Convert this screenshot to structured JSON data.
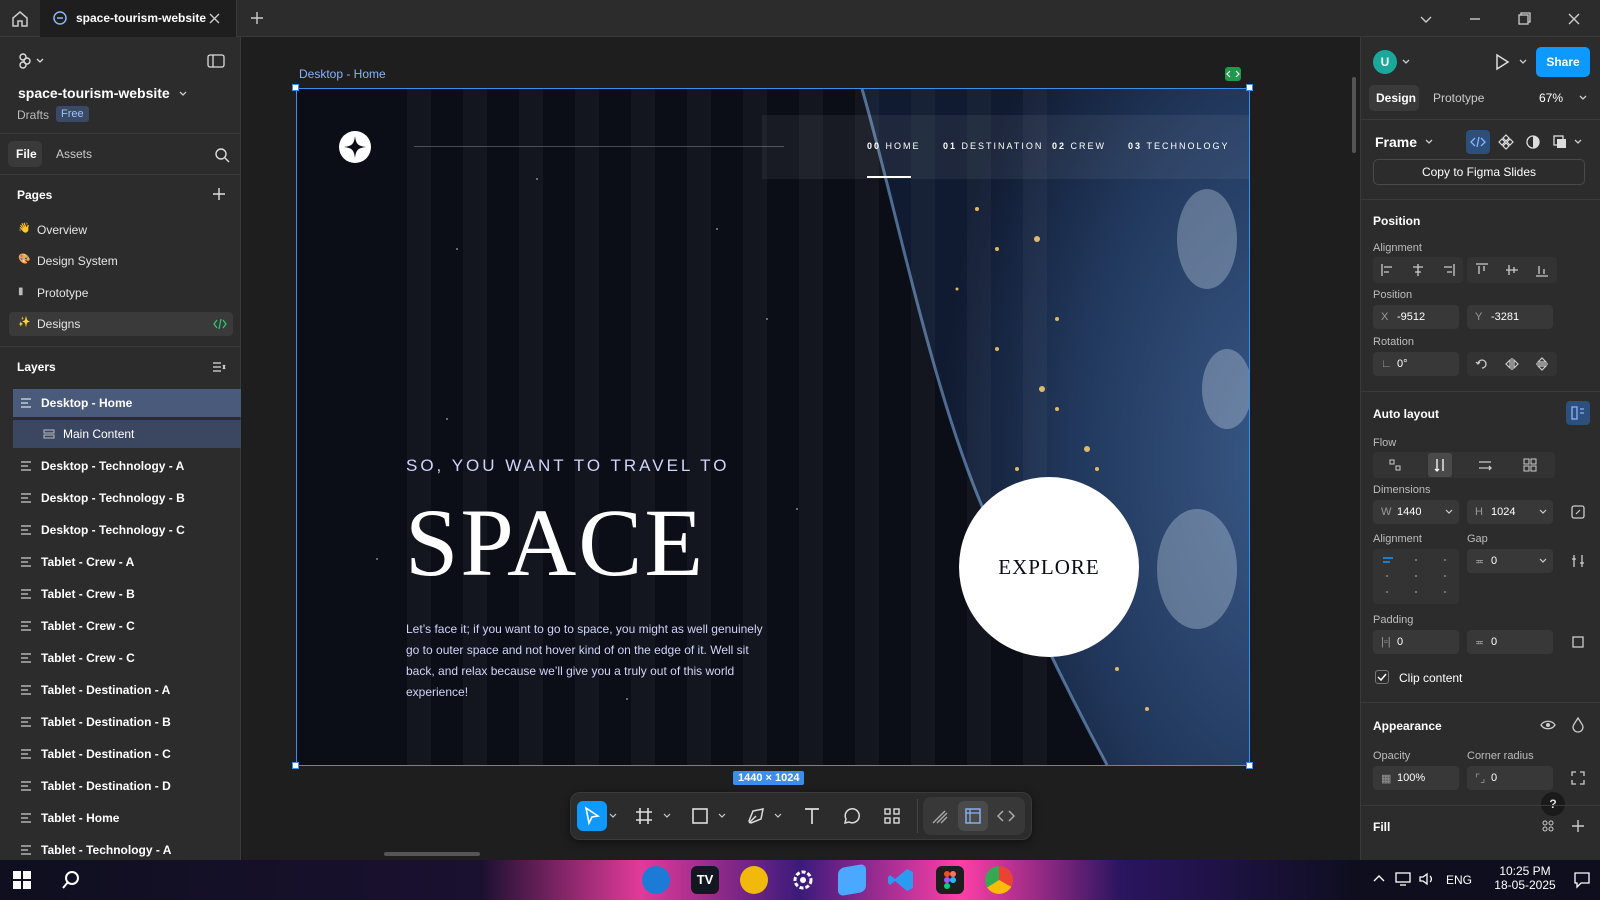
{
  "titlebar": {
    "tab_title": "space-tourism-website"
  },
  "left_panel": {
    "file_name": "space-tourism-website",
    "drafts": "Drafts",
    "plan_badge": "Free",
    "tabs": {
      "file": "File",
      "assets": "Assets"
    },
    "pages_heading": "Pages",
    "pages": [
      {
        "label": "Overview",
        "emoji": "👋"
      },
      {
        "label": "Design System",
        "emoji": "🎨"
      },
      {
        "label": "Prototype",
        "emoji": "▮"
      },
      {
        "label": "Designs",
        "emoji": "✨"
      }
    ],
    "layers_heading": "Layers",
    "layers": [
      "Desktop - Home",
      "Main Content",
      "Desktop - Technology - A",
      "Desktop - Technology - B",
      "Desktop - Technology - C",
      "Tablet - Crew - A",
      "Tablet - Crew - B",
      "Tablet - Crew - C",
      "Tablet - Crew - C",
      "Tablet - Destination - A",
      "Tablet - Destination - B",
      "Tablet - Destination - C",
      "Tablet - Destination - D",
      "Tablet - Home",
      "Tablet - Technology - A"
    ]
  },
  "canvas": {
    "frame_label": "Desktop - Home",
    "size_badge": "1440 × 1024",
    "site": {
      "nav": [
        {
          "num": "00",
          "label": "HOME"
        },
        {
          "num": "01",
          "label": "DESTINATION"
        },
        {
          "num": "02",
          "label": "CREW"
        },
        {
          "num": "03",
          "label": "TECHNOLOGY"
        }
      ],
      "subtitle": "SO, YOU WANT TO TRAVEL TO",
      "headline": "SPACE",
      "body": "Let’s face it; if you want to go to space, you might as well genuinely go to outer space and not hover kind of on the edge of it. Well sit back, and relax because we’ll give you a truly out of this world experience!",
      "cta": "EXPLORE"
    }
  },
  "right_panel": {
    "tabs": {
      "design": "Design",
      "prototype": "Prototype"
    },
    "zoom": "67%",
    "avatar": "U",
    "share": "Share",
    "frame_label": "Frame",
    "copy_button": "Copy to Figma Slides",
    "position_heading": "Position",
    "alignment_label": "Alignment",
    "position_label": "Position",
    "x": "-9512",
    "y": "-3281",
    "rotation_label": "Rotation",
    "rotation": "0°",
    "autolayout_heading": "Auto layout",
    "flow_label": "Flow",
    "dimensions_label": "Dimensions",
    "w": "1440",
    "h": "1024",
    "al_alignment_label": "Alignment",
    "gap_label": "Gap",
    "gap": "0",
    "padding_label": "Padding",
    "padding_h": "0",
    "padding_v": "0",
    "clip_label": "Clip content",
    "appearance_heading": "Appearance",
    "opacity_label": "Opacity",
    "opacity": "100%",
    "radius_label": "Corner radius",
    "radius": "0",
    "fill_heading": "Fill"
  },
  "taskbar": {
    "lang": "ENG",
    "time": "10:25 PM",
    "date": "18-05-2025"
  }
}
